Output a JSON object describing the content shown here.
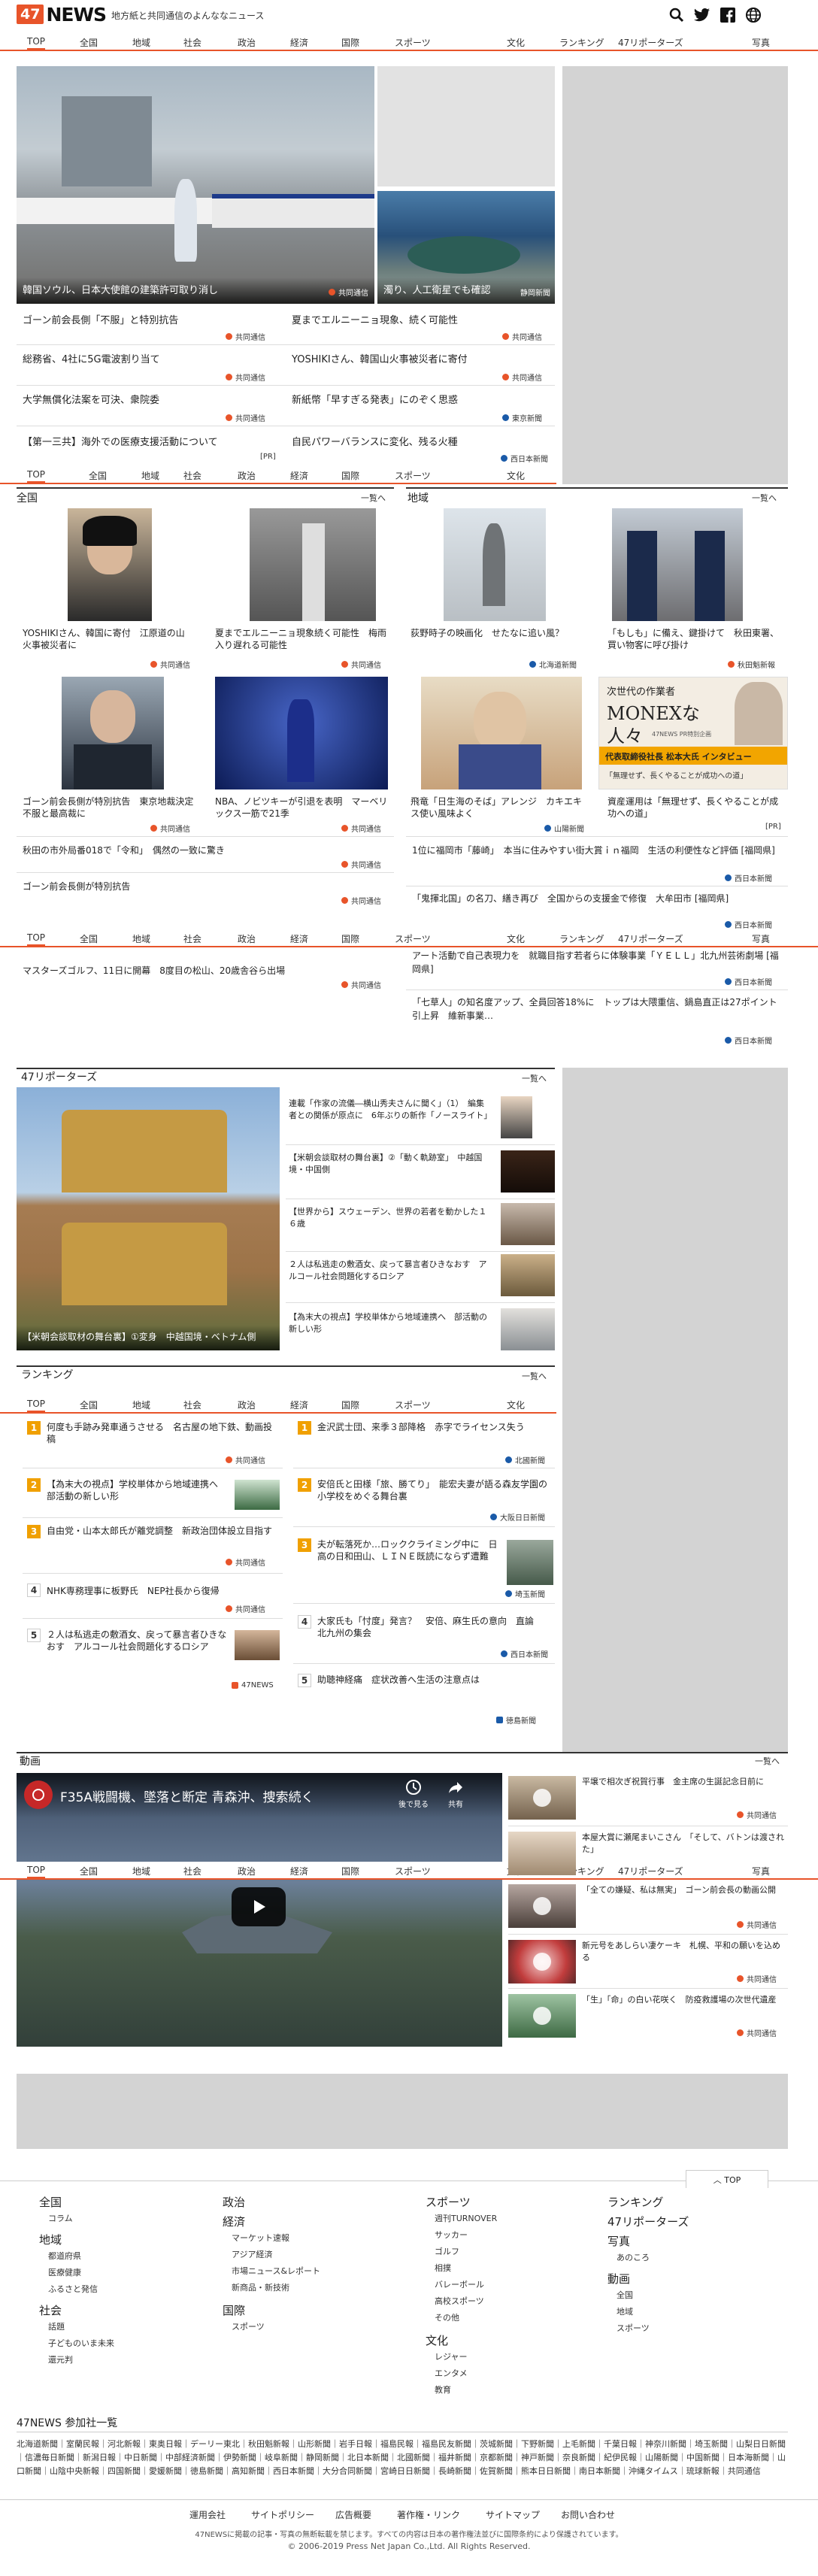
{
  "header": {
    "logo_num": "47",
    "logo_word": "NEWS",
    "tagline": "地方紙と共同通信のよんななニュース"
  },
  "nav": {
    "items": [
      "TOP",
      "全国",
      "地域",
      "社会",
      "政治",
      "経済",
      "国際",
      "スポーツ",
      "文化",
      "ランキング",
      "47リポーターズ",
      "写真"
    ]
  },
  "hero": {
    "main_caption": "韓国ソウル、日本大使館の建築許可取り消し",
    "main_source": "共同通信",
    "side_caption": "濁り、人工衛星でも確認",
    "side_source": "静岡新聞"
  },
  "top_headlines": [
    {
      "title": "ゴーン前会長側「不服」と特別抗告",
      "source": "共同通信"
    },
    {
      "title": "夏までエルニーニョ現象、続く可能性",
      "source": "共同通信"
    },
    {
      "title": "総務省、4社に5G電波割り当て",
      "source": "共同通信"
    },
    {
      "title": "YOSHIKIさん、韓国山火事被災者に寄付",
      "source": "共同通信"
    },
    {
      "title": "大学無償化法案を可決、衆院委",
      "source": "共同通信"
    },
    {
      "title": "新紙幣「早すぎる発表」にのぞく思惑",
      "source": "東京新聞"
    },
    {
      "title": "【第一三共】海外での医療支援活動について",
      "source": "[PR]"
    },
    {
      "title": "自民パワーバランスに変化、残る火種",
      "source": "西日本新聞"
    }
  ],
  "national": {
    "title": "全国",
    "more": "一覧へ",
    "cards": [
      {
        "title": "YOSHIKIさん、韓国に寄付　江原道の山火事被災者に",
        "source": "共同通信"
      },
      {
        "title": "夏までエルニーニョ現象続く可能性　梅雨入り遅れる可能性",
        "source": "共同通信"
      },
      {
        "title": "ゴーン前会長側が特別抗告　東京地裁決定不服と最高裁に",
        "source": "共同通信"
      },
      {
        "title": "NBA、ノビツキーが引退を表明　マーベリックス一筋で21季",
        "source": "共同通信"
      }
    ],
    "list": [
      {
        "title": "秋田の市外局番018で「令和」　偶然の一致に驚き",
        "source": "共同通信"
      },
      {
        "title": "ゴーン前会長側が特別抗告",
        "source": "共同通信"
      },
      {
        "title": "マスターズゴルフ、11日に開幕　8度目の松山、20歳舎谷ら出場",
        "source": "共同通信"
      }
    ]
  },
  "regional": {
    "title": "地域",
    "more": "一覧へ",
    "cards": [
      {
        "title": "荻野時子の映画化　せたなに追い風？",
        "source": "北海道新聞"
      },
      {
        "title": "「もしも」に備え、鍵掛けて　秋田東署、買い物客に呼び掛け",
        "source": "秋田魁新報"
      },
      {
        "title": "飛竜「日生海のそば」アレンジ　カキエキス使い風味よく",
        "source": "山陽新聞"
      },
      {
        "title": "資産運用は「無理せず、長くやることが成功への道」",
        "source": "[PR]"
      }
    ],
    "ad_lines": [
      "次世代の作業者",
      "MONEXな",
      "人々",
      "47NEWS PR特別企画",
      "代表取締役社長 松本大氏 インタビュー",
      "「無理せず、長くやることが成功への道」"
    ],
    "list": [
      {
        "title": "1位に福岡市「藤崎」　本当に住みやすい街大賞ｉｎ福岡　生活の利便性など評価 [福岡県]",
        "source": "西日本新聞"
      },
      {
        "title": "「鬼揮北国」の名刀、繕き再び　全国からの支援金で修復　大牟田市 [福岡県]",
        "source": "西日本新聞"
      },
      {
        "title": "アート活動で自己表現力を　就職目指す若者らに体験事業「ＹＥＬＬ」北九州芸術劇場 [福岡県]",
        "source": "西日本新聞"
      },
      {
        "title": "「七草人」の知名度アップ、全員回答18%に　トップは大隈重信、鍋島直正は27ポイント引上昇　維新事業…",
        "source": "西日本新聞"
      }
    ]
  },
  "reporters": {
    "title": "47リポーターズ",
    "more": "一覧へ",
    "main_caption": "【米朝会談取材の舞台裏】①変身　中越国境・ベトナム側",
    "items": [
      "連載「作家の流儀―横山秀夫さんに聞く」（1）　編集者との関係が原点に　6年ぶりの新作「ノースライト」",
      "【米朝会談取材の舞台裏】②「動く軌跡室」　中越国境・中国側",
      "【世界から】スウェーデン、世界の若者を動かした１６歳",
      "２人は私逃走の敷酒女、戻って暴言者ひきなおす　アルコール社会問題化するロシア",
      "【為末大の視点】学校単体から地域連携へ　部活動の新しい形"
    ]
  },
  "ranking": {
    "title": "ランキング",
    "more": "一覧へ",
    "left": [
      {
        "rank": "1",
        "title": "何度も手跡み発車通うさせる　名古屋の地下鉄、動画投稿",
        "source": "共同通信"
      },
      {
        "rank": "2",
        "title": "【為末大の視点】学校単体から地域連携へ　部活動の新しい形",
        "source": "共同通信"
      },
      {
        "rank": "3",
        "title": "自由党・山本太郎氏が離党調整　新政治団体設立目指す",
        "source": "共同通信"
      },
      {
        "rank": "4",
        "title": "NHK専務理事に板野氏　NEP社長から復帰",
        "source": "共同通信"
      },
      {
        "rank": "5",
        "title": "２人は私逃走の敷酒女、戻って暴言者ひきなおす　アルコール社会問題化するロシア",
        "source": "47NEWS"
      }
    ],
    "right": [
      {
        "rank": "1",
        "title": "金沢武士団、来季３部降格　赤字でライセンス失う",
        "source": "北國新聞"
      },
      {
        "rank": "2",
        "title": "安倍氏と田様「旅、勝てり」　能宏夫妻が語る森友学園の小学校をめぐる舞台裏",
        "source": "大阪日日新聞"
      },
      {
        "rank": "3",
        "title": "夫が転落死か…ロッククライミング中に　日高の日和田山、ＬＩＮＥ既読にならず遭難",
        "source": "埼玉新聞"
      },
      {
        "rank": "4",
        "title": "大家氏も「忖度」発言？　安倍、麻生氏の意向　直論　北九州の集会",
        "source": "西日本新聞"
      },
      {
        "rank": "5",
        "title": "助聴神経痛　症状改善へ生活の注意点は",
        "source": "徳島新聞"
      }
    ]
  },
  "video": {
    "title": "動画",
    "more": "一覧へ",
    "main_title": "F35A戦闘機、墜落と断定 青森沖、捜索続く",
    "watch_later": "後で見る",
    "share": "共有",
    "items": [
      {
        "title": "平壌で相次ぎ祝賀行事　金主席の生誕記念日前に",
        "source": "共同通信"
      },
      {
        "title": "本屋大賞に瀬尾まいこさん　「そして、バトンは渡された」",
        "source": "共同通信"
      },
      {
        "title": "「全ての嫌疑、私は無実」　ゴーン前会長の動画公開",
        "source": "共同通信"
      },
      {
        "title": "新元号をあしらい凄ケーキ　札幌、平和の願いを込める",
        "source": "共同通信"
      },
      {
        "title": "「生」「命」の白い花咲く　防疫救護場の次世代遺産",
        "source": "共同通信"
      }
    ]
  },
  "footer": {
    "top_link": "TOP",
    "columns": [
      {
        "title": "全国",
        "items": [
          "コラム"
        ]
      },
      {
        "title": "地域",
        "items": [
          "都道府県",
          "医療健康",
          "ふるさと発信"
        ]
      },
      {
        "title": "社会",
        "items": [
          "話題",
          "子どものいま未来",
          "還元判"
        ]
      },
      {
        "title": "政治",
        "items": []
      },
      {
        "title": "経済",
        "items": [
          "マーケット速報",
          "アジア経済",
          "市場ニュース&レポート",
          "新商品・新技術"
        ]
      },
      {
        "title": "国際",
        "items": [
          "スポーツ"
        ]
      },
      {
        "title": "スポーツ",
        "items": [
          "週刊TURNOVER",
          "サッカー",
          "ゴルフ",
          "相撲",
          "バレーボール",
          "高校スポーツ",
          "その他"
        ]
      },
      {
        "title": "文化",
        "items": [
          "レジャー",
          "エンタメ",
          "教育"
        ]
      },
      {
        "title": "ランキング",
        "items": []
      },
      {
        "title": "47リポーターズ",
        "items": []
      },
      {
        "title": "写真",
        "items": [
          "あのころ"
        ]
      },
      {
        "title": "動画",
        "items": [
          "全国",
          "地域",
          "スポーツ"
        ]
      }
    ],
    "members_title": "47NEWS 参加社一覧",
    "members": "北海道新聞｜室蘭民報｜河北新報｜東奥日報｜デーリー東北｜秋田魁新報｜山形新聞｜岩手日報｜福島民報｜福島民友新聞｜茨城新聞｜下野新聞｜上毛新聞｜千葉日報｜神奈川新聞｜埼玉新聞｜山梨日日新聞｜信濃毎日新聞｜新潟日報｜中日新聞｜中部経済新聞｜伊勢新聞｜岐阜新聞｜静岡新聞｜北日本新聞｜北國新聞｜福井新聞｜京都新聞｜神戸新聞｜奈良新聞｜紀伊民報｜山陽新聞｜中国新聞｜日本海新聞｜山口新聞｜山陰中央新報｜四国新聞｜愛媛新聞｜徳島新聞｜高知新聞｜西日本新聞｜大分合同新聞｜宮崎日日新聞｜長崎新聞｜佐賀新聞｜熊本日日新聞｜南日本新聞｜沖縄タイムス｜琉球新報｜共同通信",
    "links": [
      "運用会社",
      "サイトポリシー",
      "広告概要",
      "著作権・リンク",
      "サイトマップ",
      "お問い合わせ"
    ],
    "notice": "47NEWSに掲載の記事・写真の無断転載を禁じます。すべての内容は日本の著作権法並びに国際条約により保護されています。",
    "copyright": "© 2006-2019 Press Net Japan Co.,Ltd. All Rights Reserved."
  },
  "colors": {
    "accent": "#e8542a",
    "rank": "#f0a000",
    "ad": "#d3d3d3"
  }
}
